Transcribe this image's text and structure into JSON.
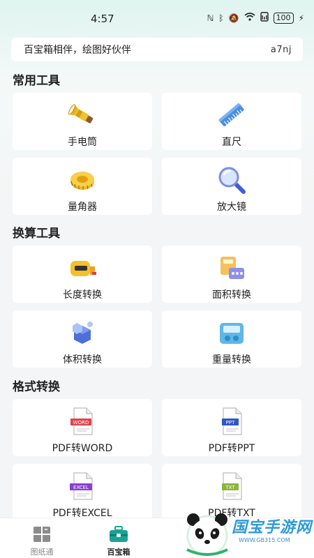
{
  "status": {
    "time": "4:57",
    "battery": "100"
  },
  "banner": {
    "text": "百宝箱相伴，绘图好伙伴",
    "code": "a7nj"
  },
  "sections": {
    "common": "常用工具",
    "convert": "换算工具",
    "format": "格式转换"
  },
  "tools": {
    "flashlight": "手电筒",
    "ruler": "直尺",
    "protractor": "量角器",
    "magnifier": "放大镜",
    "length": "长度转换",
    "area": "面积转换",
    "volume": "体积转换",
    "weight": "重量转换",
    "pdf_word": "PDF转WORD",
    "pdf_ppt": "PDF转PPT",
    "pdf_excel": "PDF转EXCEL",
    "pdf_txt": "PDF转TXT"
  },
  "file_badges": {
    "word": "WORD",
    "ppt": "PPT",
    "excel": "EXCEL",
    "txt": "TXT"
  },
  "tabs": {
    "drawings": "图纸通",
    "toolbox": "百宝箱"
  },
  "watermark": {
    "text": "国宝手游网",
    "url": "WWW.GB315.COM"
  },
  "colors": {
    "accent": "#1aa394",
    "word": "#e0424b",
    "ppt": "#2e56c8",
    "excel": "#8a3fd0",
    "txt": "#8cb43a"
  }
}
